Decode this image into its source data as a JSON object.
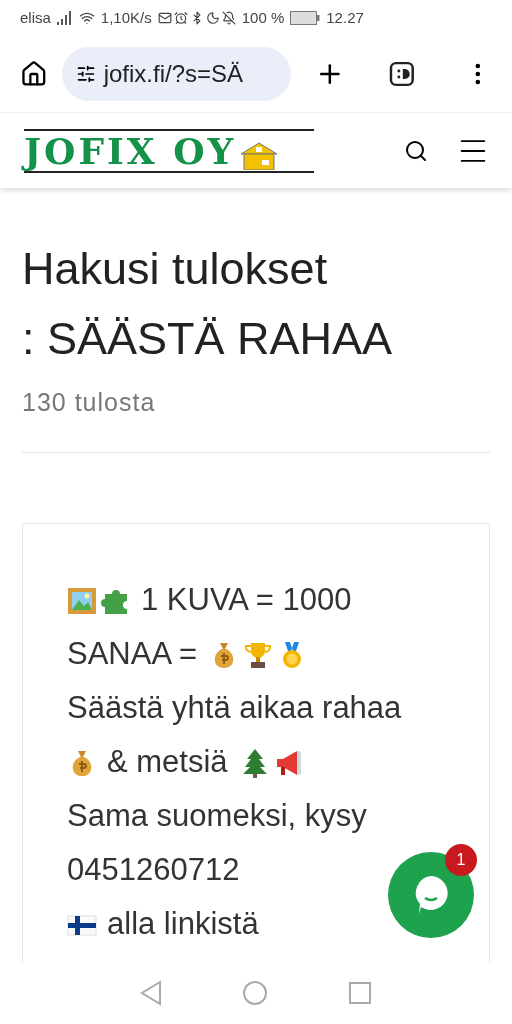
{
  "status_bar": {
    "carrier": "elisa",
    "speed": "1,10K/s",
    "battery": "100 %",
    "time": "12.27"
  },
  "browser": {
    "url": "jofix.fi/?s=SÄ"
  },
  "site_header": {
    "logo_text": "JOFIX OY"
  },
  "results": {
    "heading_lines": [
      "Hakusi tulokset",
      ": SÄÄSTÄ RAHAA"
    ],
    "count": "130 tulosta"
  },
  "card": {
    "lines": [
      "1 KUVA = 1000",
      "SANAA =",
      "Säästä yhtä aikaa rahaa",
      "& metsiä",
      "Sama suomeksi, kysy",
      "0451260712",
      "alla linkistä"
    ]
  },
  "chat": {
    "badge": "1"
  }
}
